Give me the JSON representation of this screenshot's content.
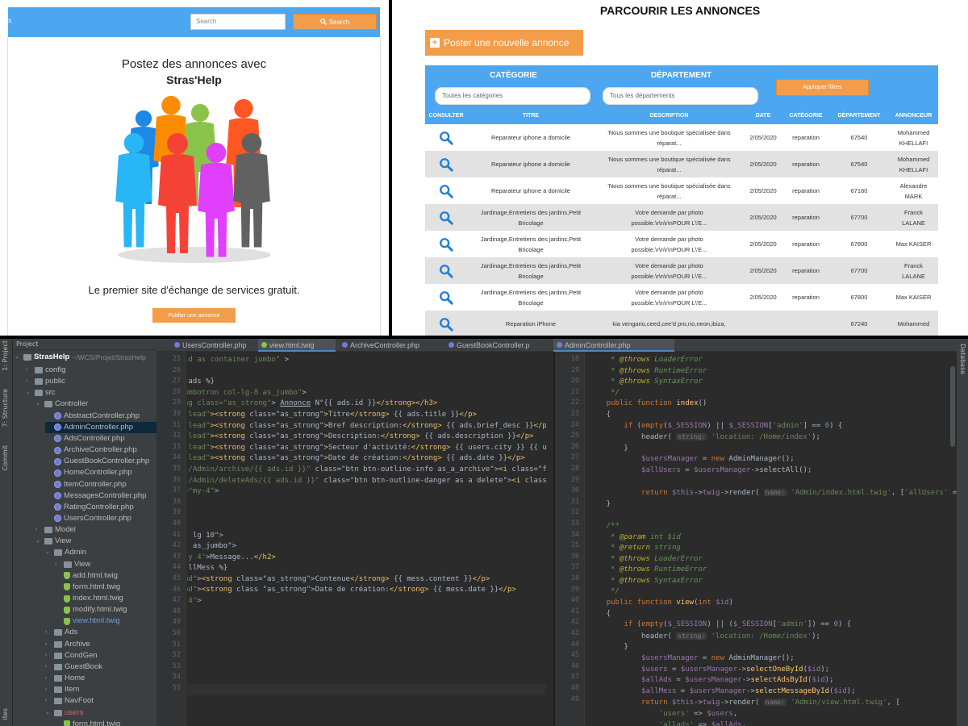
{
  "home": {
    "brand": "s",
    "search_placeholder": "Search",
    "search_button": "Search",
    "hero_line1": "Postez des annonces avec",
    "hero_line2": "Stras'Help",
    "tagline": "Le premier site d'échange de services gratuit.",
    "publish_button": "Publier une annonce",
    "people_colors": [
      "#1e88e5",
      "#fb8c00",
      "#8bc34a",
      "#ff5722",
      "#29b6f6",
      "#f44336",
      "#e040fb",
      "#616161"
    ]
  },
  "listing": {
    "title": "PARCOURIR LES ANNONCES",
    "post_button": "Poster une nouvelle annonce",
    "filter_category_label": "CATÉGORIE",
    "filter_department_label": "DÉPARTEMENT",
    "filter_category_value": "Toutes les catégories",
    "filter_department_value": "Tous les départements",
    "apply_button": "Appliquer filtres",
    "columns": [
      "CONSULTER",
      "TITRE",
      "DESCRIPTION",
      "DATE",
      "CATÉGORIE",
      "DÉPARTEMENT",
      "ANNONCEUR"
    ],
    "rows": [
      {
        "title": "Reparateur iphone a domicile",
        "desc1": "'Nous sommes une boutique spécialisée dans",
        "desc2": "réparat...",
        "date": "2/05/2020",
        "cat": "reparation",
        "dept": "67540",
        "user1": "Mohammed",
        "user2": "KHELLAFI"
      },
      {
        "title": "Reparateur iphone a domicile",
        "desc1": "'Nous sommes une boutique spécialisée dans",
        "desc2": "réparat...",
        "date": "2/05/2020",
        "cat": "reparation",
        "dept": "67540",
        "user1": "Mohammed",
        "user2": "KHELLAFI"
      },
      {
        "title": "Reparateur iphone a domicile",
        "desc1": "'Nous sommes une boutique spécialisée dans",
        "desc2": "réparat...",
        "date": "2/05/2020",
        "cat": "reparation",
        "dept": "67160",
        "user1": "Alexandre",
        "user2": "MARK"
      },
      {
        "title": "Jardinage,Entretiens des jardins,Petit Bricolage",
        "desc1": "Votre demande par photo",
        "desc2": "possible.\\r\\n\\r\\nPOUR L\\'E...",
        "date": "2/05/2020",
        "cat": "reparation",
        "dept": "67700",
        "user1": "Franck",
        "user2": "LALANE"
      },
      {
        "title": "Jardinage,Entretiens des jardins,Petit Bricolage",
        "desc1": "Votre demande par photo",
        "desc2": "possible.\\r\\n\\r\\nPOUR L\\'E...",
        "date": "2/05/2020",
        "cat": "reparation",
        "dept": "67800",
        "user1": "Max KAISER",
        "user2": ""
      },
      {
        "title": "Jardinage,Entretiens des jardins,Petit Bricolage",
        "desc1": "Votre demande par photo",
        "desc2": "possible.\\r\\n\\r\\nPOUR L\\'E...",
        "date": "2/05/2020",
        "cat": "reparation",
        "dept": "67700",
        "user1": "Franck",
        "user2": "LALANE"
      },
      {
        "title": "Jardinage,Entretiens des jardins,Petit Bricolage",
        "desc1": "Votre demande par photo",
        "desc2": "possible.\\r\\n\\r\\nPOUR L\\'E...",
        "date": "2/05/2020",
        "cat": "reparation",
        "dept": "67800",
        "user1": "Max KAISER",
        "user2": ""
      },
      {
        "title": "Reparation iPhone",
        "desc1": "kia vengario,ceed,cee'd pro,rio,neon,ibiza,",
        "desc2": "",
        "date": "",
        "cat": "",
        "dept": "67240",
        "user1": "Mohammed",
        "user2": ""
      }
    ]
  },
  "ide": {
    "project_label": "Project",
    "tool_structure": "7: Structure",
    "tool_project": "1: Project",
    "tool_commit": "Commit",
    "tool_favorites": "ites",
    "tool_database": "Database",
    "root": "StrasHelp",
    "root_path": "~/WCS/Projet/StrasHelp",
    "tree": [
      {
        "label": "config",
        "kind": "folder",
        "depth": 1,
        "arrow": "›"
      },
      {
        "label": "public",
        "kind": "folder",
        "depth": 1,
        "arrow": "›"
      },
      {
        "label": "src",
        "kind": "folder",
        "depth": 1,
        "arrow": "⌄"
      },
      {
        "label": "Controller",
        "kind": "folder",
        "depth": 2,
        "arrow": "⌄"
      },
      {
        "label": "AbstractController.php",
        "kind": "php",
        "depth": 3
      },
      {
        "label": "AdminController.php",
        "kind": "php",
        "depth": 3,
        "selected": true
      },
      {
        "label": "AdsController.php",
        "kind": "php",
        "depth": 3
      },
      {
        "label": "ArchiveController.php",
        "kind": "php",
        "depth": 3
      },
      {
        "label": "GuestBookController.php",
        "kind": "php",
        "depth": 3
      },
      {
        "label": "HomeController.php",
        "kind": "php",
        "depth": 3
      },
      {
        "label": "ItemController.php",
        "kind": "php",
        "depth": 3
      },
      {
        "label": "MessagesController.php",
        "kind": "php",
        "depth": 3
      },
      {
        "label": "RatingController.php",
        "kind": "php",
        "depth": 3
      },
      {
        "label": "UsersController.php",
        "kind": "php",
        "depth": 3
      },
      {
        "label": "Model",
        "kind": "folder",
        "depth": 2,
        "arrow": "›"
      },
      {
        "label": "View",
        "kind": "folder",
        "depth": 2,
        "arrow": "⌄"
      },
      {
        "label": "Admin",
        "kind": "folder",
        "depth": 3,
        "arrow": "⌄"
      },
      {
        "label": "View",
        "kind": "folder",
        "depth": 4,
        "arrow": "›"
      },
      {
        "label": "add.html.twig",
        "kind": "twig",
        "depth": 4
      },
      {
        "label": "form.html.twig",
        "kind": "twig",
        "depth": 4
      },
      {
        "label": "index.html.twig",
        "kind": "twig",
        "depth": 4
      },
      {
        "label": "modify.html.twig",
        "kind": "twig",
        "depth": 4
      },
      {
        "label": "view.html.twig",
        "kind": "twig",
        "depth": 4,
        "highlight": true
      },
      {
        "label": "Ads",
        "kind": "folder",
        "depth": 3,
        "arrow": "›"
      },
      {
        "label": "Archive",
        "kind": "folder",
        "depth": 3,
        "arrow": "›"
      },
      {
        "label": "CondGen",
        "kind": "folder",
        "depth": 3,
        "arrow": "›"
      },
      {
        "label": "GuestBook",
        "kind": "folder",
        "depth": 3,
        "arrow": "›"
      },
      {
        "label": "Home",
        "kind": "folder",
        "depth": 3,
        "arrow": "›"
      },
      {
        "label": "Item",
        "kind": "folder",
        "depth": 3,
        "arrow": "›"
      },
      {
        "label": "NavFoot",
        "kind": "folder",
        "depth": 3,
        "arrow": "›"
      },
      {
        "label": "users",
        "kind": "folder",
        "depth": 3,
        "arrow": "⌄"
      },
      {
        "label": "form.html.twig",
        "kind": "twig",
        "depth": 4
      }
    ],
    "tabs": [
      {
        "label": "UsersController.php",
        "color": "#6f7bd6",
        "active": false
      },
      {
        "label": "view.html.twig",
        "color": "#8bc34a",
        "active": true
      },
      {
        "label": "ArchiveController.php",
        "color": "#6f7bd6",
        "active": false
      },
      {
        "label": "GuestBookController.p",
        "color": "#6f7bd6",
        "active": false
      },
      {
        "label": "AdminController.php",
        "color": "#6f7bd6",
        "active": true
      }
    ],
    "left_lines": [
      "25",
      "26",
      "27",
      "28",
      "29",
      "30",
      "31",
      "32",
      "33",
      "34",
      "35",
      "36",
      "37",
      "38",
      "39",
      "40",
      "41",
      "42",
      "43",
      "44",
      "45",
      "46",
      "47",
      "48",
      "49",
      "50",
      "51",
      "52",
      "53",
      "54",
      "55"
    ],
    "right_lines": [
      "18",
      "19",
      "20",
      "21",
      "22",
      "23",
      "24",
      "25",
      "26",
      "27",
      "28",
      "29",
      "30",
      "31",
      "32",
      "33",
      "34",
      "35",
      "36",
      "37",
      "38",
      "39",
      "40",
      "41",
      "42",
      "43",
      "44",
      "45",
      "46",
      "47",
      "48",
      "49"
    ],
    "param_hint_string": "string:",
    "param_hint_name": "name:"
  }
}
